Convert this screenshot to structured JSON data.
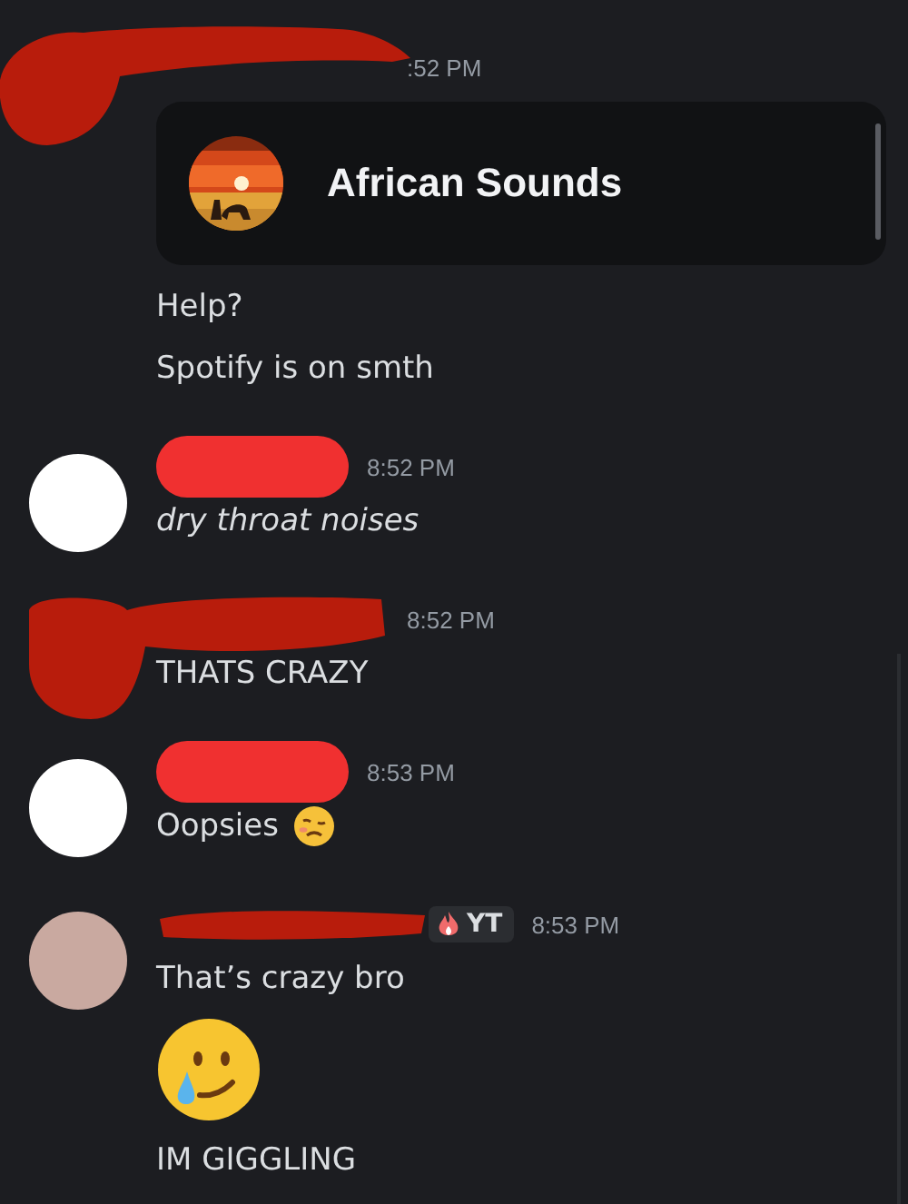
{
  "messages": [
    {
      "avatar": {
        "kind": "covered"
      },
      "name_cover": {
        "kind": "scribble-wide"
      },
      "timestamp": ":52 PM",
      "items": [
        {
          "kind": "embed",
          "title": "African Sounds"
        },
        {
          "kind": "text",
          "text": "Help?",
          "italic": false
        },
        {
          "kind": "text",
          "text": "Spotify is on smth",
          "italic": false
        }
      ]
    },
    {
      "avatar": {
        "kind": "light"
      },
      "name_cover": {
        "kind": "pill"
      },
      "timestamp": "8:52 PM",
      "items": [
        {
          "kind": "text",
          "text": "dry throat noises",
          "italic": true
        }
      ]
    },
    {
      "avatar": {
        "kind": "covered"
      },
      "name_cover": {
        "kind": "scribble-long"
      },
      "timestamp": "8:52 PM",
      "items": [
        {
          "kind": "text",
          "text": "THATS CRAZY",
          "italic": false
        }
      ]
    },
    {
      "avatar": {
        "kind": "light"
      },
      "name_cover": {
        "kind": "pill"
      },
      "timestamp": "8:53 PM",
      "items": [
        {
          "kind": "text-with-woozy-emoji",
          "text": "Oopsies",
          "italic": false
        }
      ]
    },
    {
      "avatar": {
        "kind": "skin"
      },
      "name_cover": {
        "kind": "scribble-thin"
      },
      "badge": "YT",
      "timestamp": "8:53 PM",
      "items": [
        {
          "kind": "text",
          "text": "That’s crazy bro",
          "italic": false
        },
        {
          "kind": "tear-smile-emoji"
        },
        {
          "kind": "text",
          "text": "IM GIGGLING",
          "italic": false
        }
      ]
    }
  ]
}
